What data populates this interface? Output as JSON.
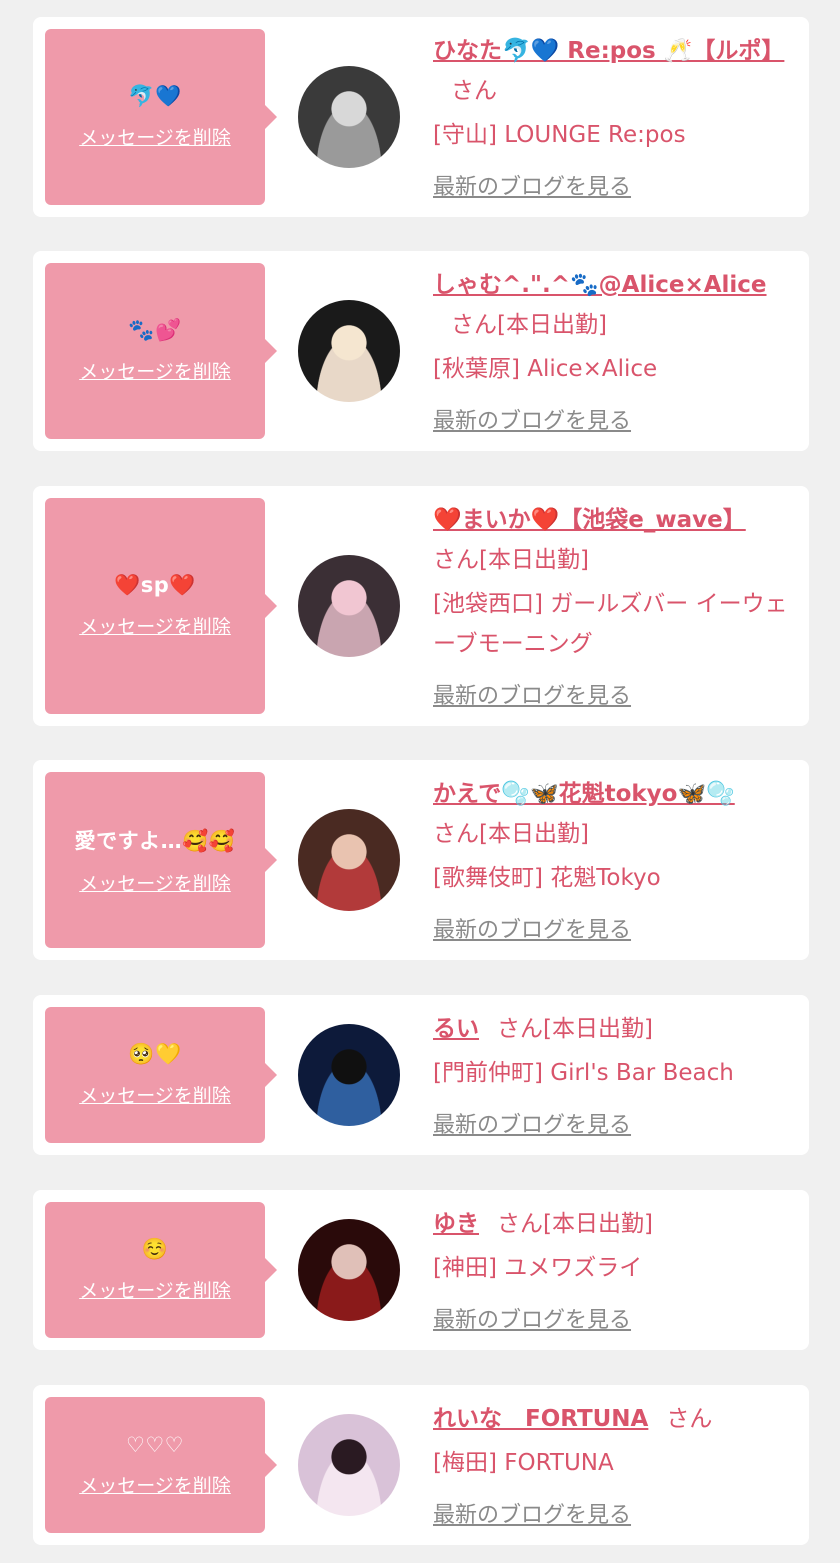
{
  "cards": [
    {
      "message": "🐬💙",
      "delete_label": "メッセージを削除",
      "name": "ひなた🐬💙 Re:pos 🥂【ルポ】",
      "suffix": "さん",
      "shop": "[守山] LOUNGE Re:pos",
      "blog_label": "最新のブログを見る",
      "avatar_colors": [
        "#3a3a3a",
        "#9a9a9a",
        "#d8d8d8"
      ]
    },
    {
      "message": "🐾💕",
      "delete_label": "メッセージを削除",
      "name": "しゃむ^.\".^🐾@Alice×Alice",
      "suffix": "さん[本日出勤]",
      "shop": "[秋葉原] Alice×Alice",
      "blog_label": "最新のブログを見る",
      "avatar_colors": [
        "#1a1a1a",
        "#e8d8c8",
        "#f5e6d0"
      ]
    },
    {
      "message": "❤️sp❤️",
      "delete_label": "メッセージを削除",
      "name": "❤️まいか❤️【池袋e_wave】",
      "suffix": "さん[本日出勤]",
      "shop": "[池袋西口] ガールズバー イーウェーブモーニング",
      "blog_label": "最新のブログを見る",
      "avatar_colors": [
        "#3b2f35",
        "#c9a5b0",
        "#f1c6d2"
      ]
    },
    {
      "message": "愛ですよ…🥰🥰",
      "delete_label": "メッセージを削除",
      "name": "かえで🫧🦋花魁tokyo🦋🫧",
      "suffix": "さん[本日出勤]",
      "shop": "[歌舞伎町] 花魁Tokyo",
      "blog_label": "最新のブログを見る",
      "avatar_colors": [
        "#4a2a22",
        "#b23a3a",
        "#e9c3b0"
      ]
    },
    {
      "message": "🥺💛",
      "delete_label": "メッセージを削除",
      "name": "るい",
      "suffix": "さん[本日出勤]",
      "shop": "[門前仲町] Girl's Bar Beach",
      "blog_label": "最新のブログを見る",
      "avatar_colors": [
        "#0d1a3a",
        "#2f5f9f",
        "#101010"
      ]
    },
    {
      "message": "☺️",
      "delete_label": "メッセージを削除",
      "name": "ゆき",
      "suffix": "さん[本日出勤]",
      "shop": "[神田] ユメワズライ",
      "blog_label": "最新のブログを見る",
      "avatar_colors": [
        "#2a0a0a",
        "#8a1a1a",
        "#e0c0b8"
      ]
    },
    {
      "message": "♡♡♡",
      "delete_label": "メッセージを削除",
      "name": "れいな　FORTUNA",
      "suffix": "さん",
      "shop": "[梅田] FORTUNA",
      "blog_label": "最新のブログを見る",
      "avatar_colors": [
        "#d9c2d8",
        "#f4e6f0",
        "#2a1a22"
      ]
    }
  ]
}
